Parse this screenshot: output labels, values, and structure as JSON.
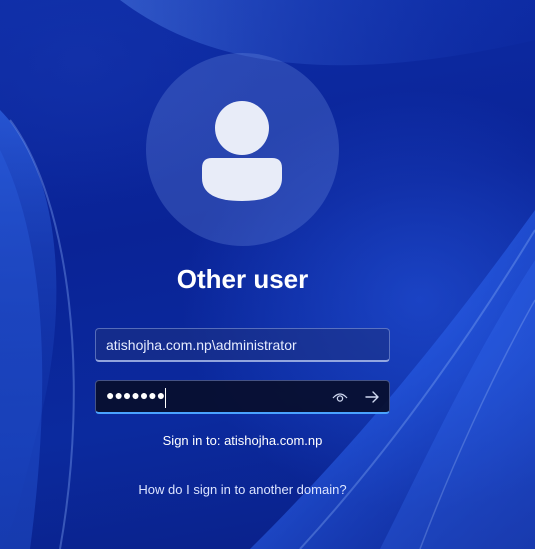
{
  "user": {
    "display_name": "Other user",
    "avatar_icon": "person-icon"
  },
  "login": {
    "username_value": "atishojha.com.np\\administrator",
    "password_masked": "●●●●●●●",
    "password_length": 7,
    "reveal_icon": "eye-icon",
    "submit_icon": "arrow-right-icon"
  },
  "domain": {
    "sign_in_to": "Sign in to: atishojha.com.np",
    "other_domain_link": "How do I sign in to another domain?"
  },
  "colors": {
    "background": "#0b2a9e",
    "accent": "#4aa3ff",
    "text": "#ffffff"
  }
}
